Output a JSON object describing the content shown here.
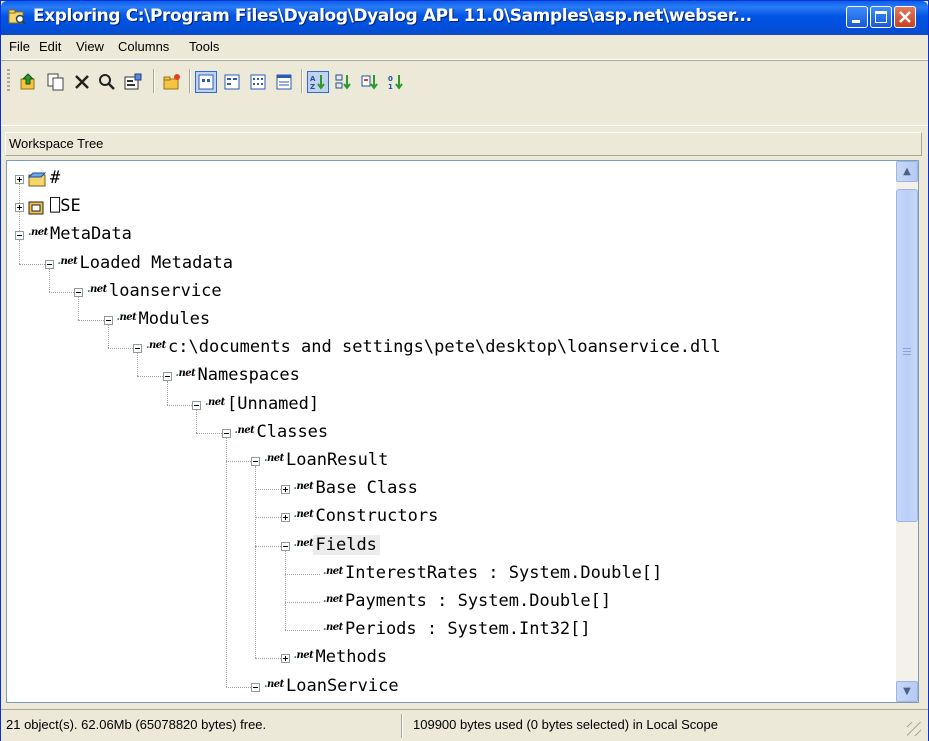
{
  "window": {
    "title": "Exploring C:\\Program Files\\Dyalog\\Dyalog APL 11.0\\Samples\\asp.net\\webser...",
    "icon": "explorer-icon"
  },
  "menu": [
    "File",
    "Edit",
    "View",
    "Columns",
    "Tools"
  ],
  "toolbar": {
    "buttons": [
      "up-folder",
      "copy",
      "delete",
      "find",
      "properties",
      "new-folder",
      "large-icons",
      "small-icons",
      "list",
      "details",
      "sort-by-name",
      "sort-by-type",
      "sort-by-class",
      "sort-by-size"
    ]
  },
  "panel": {
    "header": "Workspace Tree"
  },
  "tree": [
    {
      "label": "#",
      "depth": 0,
      "icon": "folder-icon",
      "state": "collapsed"
    },
    {
      "label": "⎕SE",
      "depth": 0,
      "icon": "session-icon",
      "state": "collapsed"
    },
    {
      "label": "MetaData",
      "depth": 0,
      "icon": "net-icon",
      "state": "expanded"
    },
    {
      "label": "Loaded Metadata",
      "depth": 1,
      "icon": "net-icon",
      "state": "expanded"
    },
    {
      "label": "loanservice",
      "depth": 2,
      "icon": "net-icon",
      "state": "expanded"
    },
    {
      "label": "Modules",
      "depth": 3,
      "icon": "net-icon",
      "state": "expanded"
    },
    {
      "label": "c:\\documents and settings\\pete\\desktop\\loanservice.dll",
      "depth": 4,
      "icon": "net-icon",
      "state": "expanded"
    },
    {
      "label": "Namespaces",
      "depth": 5,
      "icon": "net-icon",
      "state": "expanded"
    },
    {
      "label": "[Unnamed]",
      "depth": 6,
      "icon": "net-icon",
      "state": "expanded"
    },
    {
      "label": "Classes",
      "depth": 7,
      "icon": "net-icon",
      "state": "expanded"
    },
    {
      "label": "LoanResult",
      "depth": 8,
      "icon": "net-icon",
      "state": "expanded"
    },
    {
      "label": "Base Class",
      "depth": 9,
      "icon": "net-icon",
      "state": "collapsed"
    },
    {
      "label": "Constructors",
      "depth": 9,
      "icon": "net-icon",
      "state": "collapsed"
    },
    {
      "label": "Fields",
      "depth": 9,
      "icon": "net-icon",
      "state": "expanded",
      "selected": true
    },
    {
      "label": "InterestRates : System.Double[]",
      "depth": 10,
      "icon": "net-icon",
      "state": "leaf"
    },
    {
      "label": "Payments : System.Double[]",
      "depth": 10,
      "icon": "net-icon",
      "state": "leaf"
    },
    {
      "label": "Periods : System.Int32[]",
      "depth": 10,
      "icon": "net-icon",
      "state": "leaf"
    },
    {
      "label": "Methods",
      "depth": 9,
      "icon": "net-icon",
      "state": "collapsed"
    },
    {
      "label": "LoanService",
      "depth": 8,
      "icon": "net-icon",
      "state": "expanded"
    }
  ],
  "status": {
    "left": "21 object(s). 62.06Mb (65078820 bytes) free.",
    "right": "109900 bytes used (0 bytes selected)  in Local Scope"
  },
  "colors": {
    "titlebar": "#0054E3",
    "chrome": "#ECE9D8",
    "selection": "#ECECEC"
  }
}
